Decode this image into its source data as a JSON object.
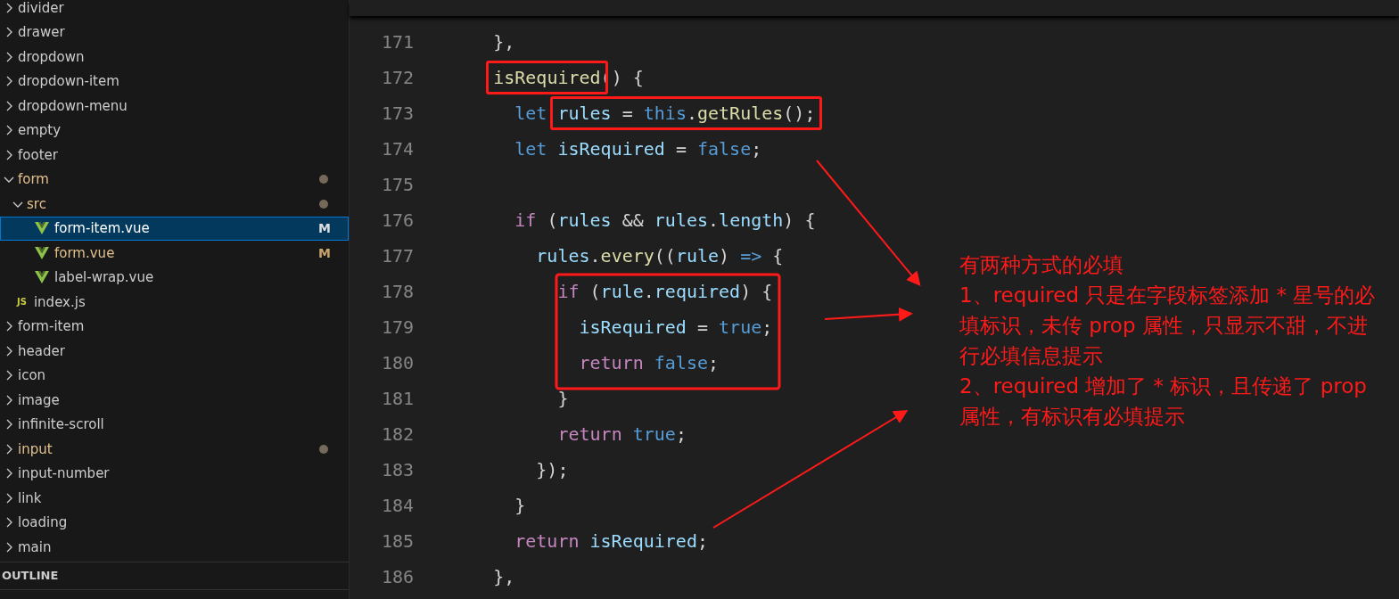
{
  "explorer": {
    "items": [
      {
        "label": "divider",
        "kind": "folder",
        "expanded": false,
        "modified": false,
        "selected": false
      },
      {
        "label": "drawer",
        "kind": "folder",
        "expanded": false,
        "modified": false,
        "selected": false
      },
      {
        "label": "dropdown",
        "kind": "folder",
        "expanded": false,
        "modified": false,
        "selected": false
      },
      {
        "label": "dropdown-item",
        "kind": "folder",
        "expanded": false,
        "modified": false,
        "selected": false
      },
      {
        "label": "dropdown-menu",
        "kind": "folder",
        "expanded": false,
        "modified": false,
        "selected": false
      },
      {
        "label": "empty",
        "kind": "folder",
        "expanded": false,
        "modified": false,
        "selected": false
      },
      {
        "label": "footer",
        "kind": "folder",
        "expanded": false,
        "modified": false,
        "selected": false
      },
      {
        "label": "form",
        "kind": "folder",
        "expanded": true,
        "modified": true,
        "selected": false,
        "children": [
          {
            "label": "src",
            "kind": "folder",
            "expanded": true,
            "modified": true,
            "selected": false,
            "children": [
              {
                "label": "form-item.vue",
                "kind": "vue",
                "modified": true,
                "badge": "M",
                "selected": true
              },
              {
                "label": "form.vue",
                "kind": "vue",
                "modified": true,
                "badge": "M",
                "selected": false
              },
              {
                "label": "label-wrap.vue",
                "kind": "vue",
                "modified": false,
                "selected": false
              }
            ]
          },
          {
            "label": "index.js",
            "kind": "js",
            "icon_text": "JS",
            "modified": false,
            "selected": false
          }
        ]
      },
      {
        "label": "form-item",
        "kind": "folder",
        "expanded": false,
        "modified": false,
        "selected": false
      },
      {
        "label": "header",
        "kind": "folder",
        "expanded": false,
        "modified": false,
        "selected": false
      },
      {
        "label": "icon",
        "kind": "folder",
        "expanded": false,
        "modified": false,
        "selected": false
      },
      {
        "label": "image",
        "kind": "folder",
        "expanded": false,
        "modified": false,
        "selected": false
      },
      {
        "label": "infinite-scroll",
        "kind": "folder",
        "expanded": false,
        "modified": false,
        "selected": false
      },
      {
        "label": "input",
        "kind": "folder",
        "expanded": false,
        "modified": true,
        "selected": false
      },
      {
        "label": "input-number",
        "kind": "folder",
        "expanded": false,
        "modified": false,
        "selected": false
      },
      {
        "label": "link",
        "kind": "folder",
        "expanded": false,
        "modified": false,
        "selected": false
      },
      {
        "label": "loading",
        "kind": "folder",
        "expanded": false,
        "modified": false,
        "selected": false
      },
      {
        "label": "main",
        "kind": "folder",
        "expanded": false,
        "modified": false,
        "selected": false
      }
    ],
    "outline": "OUTLINE"
  },
  "editor": {
    "lines": [
      {
        "number": "171",
        "tokens": [
          {
            "kind": "punc",
            "text": "    },"
          }
        ]
      },
      {
        "number": "172",
        "segments": [
          {
            "highlighted": true,
            "tokens": [
              {
                "kind": "fn",
                "text": "    isRequired"
              }
            ]
          },
          {
            "highlighted": false,
            "tokens": [
              {
                "kind": "punc",
                "text": "() {"
              }
            ]
          }
        ]
      },
      {
        "number": "173",
        "segments": [
          {
            "highlighted": false,
            "tokens": [
              {
                "kind": "kw",
                "text": "      let "
              }
            ]
          },
          {
            "highlighted": true,
            "tokens": [
              {
                "kind": "var",
                "text": "rules"
              },
              {
                "kind": "punc",
                "text": " = "
              },
              {
                "kind": "kw",
                "text": "this"
              },
              {
                "kind": "punc",
                "text": "."
              },
              {
                "kind": "fn",
                "text": "getRules"
              },
              {
                "kind": "punc",
                "text": "();"
              }
            ]
          }
        ]
      },
      {
        "number": "174",
        "tokens": [
          {
            "kind": "kw",
            "text": "      let "
          },
          {
            "kind": "var",
            "text": "isRequired"
          },
          {
            "kind": "punc",
            "text": " = "
          },
          {
            "kind": "kw",
            "text": "false"
          },
          {
            "kind": "punc",
            "text": ";"
          }
        ]
      },
      {
        "number": "175"
      },
      {
        "number": "176",
        "tokens": [
          {
            "kind": "ctrl",
            "text": "      if"
          },
          {
            "kind": "punc",
            "text": " ("
          },
          {
            "kind": "var",
            "text": "rules"
          },
          {
            "kind": "punc",
            "text": " && "
          },
          {
            "kind": "var",
            "text": "rules"
          },
          {
            "kind": "punc",
            "text": "."
          },
          {
            "kind": "var",
            "text": "length"
          },
          {
            "kind": "punc",
            "text": ") {"
          }
        ]
      },
      {
        "number": "177",
        "tokens": [
          {
            "kind": "var",
            "text": "        rules"
          },
          {
            "kind": "punc",
            "text": "."
          },
          {
            "kind": "fn",
            "text": "every"
          },
          {
            "kind": "punc",
            "text": "(("
          },
          {
            "kind": "var",
            "text": "rule"
          },
          {
            "kind": "punc",
            "text": ") "
          },
          {
            "kind": "kw",
            "text": "=>"
          },
          {
            "kind": "punc",
            "text": " {"
          }
        ]
      },
      {
        "number": "178",
        "tokens": [
          {
            "kind": "ctrl",
            "text": "          if"
          },
          {
            "kind": "punc",
            "text": " ("
          },
          {
            "kind": "var",
            "text": "rule"
          },
          {
            "kind": "punc",
            "text": "."
          },
          {
            "kind": "var",
            "text": "required"
          },
          {
            "kind": "punc",
            "text": ") {"
          }
        ]
      },
      {
        "number": "179",
        "tokens": [
          {
            "kind": "var",
            "text": "            isRequired"
          },
          {
            "kind": "punc",
            "text": " = "
          },
          {
            "kind": "kw",
            "text": "true"
          },
          {
            "kind": "punc",
            "text": ";"
          }
        ]
      },
      {
        "number": "180",
        "tokens": [
          {
            "kind": "ctrl",
            "text": "            return"
          },
          {
            "kind": "kw",
            "text": " false"
          },
          {
            "kind": "punc",
            "text": ";"
          }
        ]
      },
      {
        "number": "181",
        "tokens": [
          {
            "kind": "punc",
            "text": "          }"
          }
        ]
      },
      {
        "number": "182",
        "tokens": [
          {
            "kind": "ctrl",
            "text": "          return"
          },
          {
            "kind": "kw",
            "text": " true"
          },
          {
            "kind": "punc",
            "text": ";"
          }
        ]
      },
      {
        "number": "183",
        "tokens": [
          {
            "kind": "punc",
            "text": "        });"
          }
        ]
      },
      {
        "number": "184",
        "tokens": [
          {
            "kind": "punc",
            "text": "      }"
          }
        ]
      },
      {
        "number": "185",
        "tokens": [
          {
            "kind": "ctrl",
            "text": "      return"
          },
          {
            "kind": "var",
            "text": " isRequired"
          },
          {
            "kind": "punc",
            "text": ";"
          }
        ]
      },
      {
        "number": "186",
        "tokens": [
          {
            "kind": "punc",
            "text": "    },"
          }
        ]
      }
    ]
  },
  "note": [
    "有两种方式的必填",
    "1、required 只是在字段标签添加 * 星号的必填标识，未传 prop 属性，只显示不甜，不进行必填信息提示",
    "2、required 增加了 * 标识，且传递了 prop 属性，有标识有必填提示"
  ]
}
